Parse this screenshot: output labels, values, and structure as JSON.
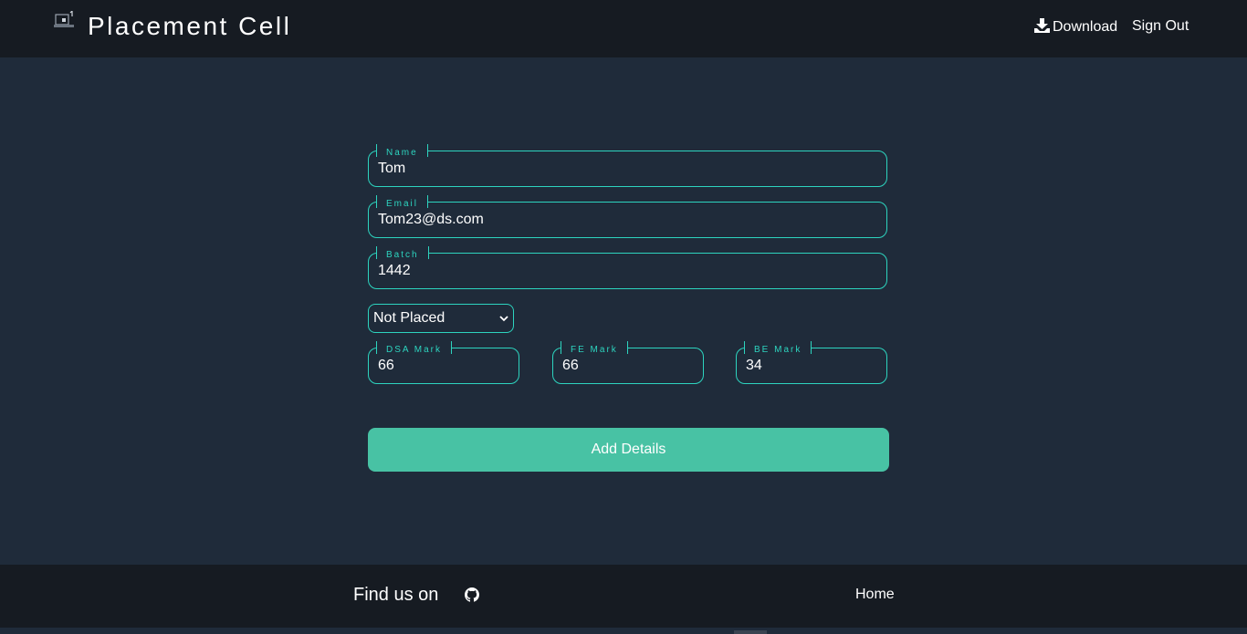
{
  "header": {
    "brand": "Placement Cell",
    "logo_icon": "laptop-icon",
    "nav": {
      "download_label": "Download",
      "download_icon": "download-icon",
      "signout_label": "Sign Out"
    }
  },
  "form": {
    "name": {
      "label": "Name",
      "value": "Tom"
    },
    "email": {
      "label": "Email",
      "value": "Tom23@ds.com"
    },
    "batch": {
      "label": "Batch",
      "value": "1442"
    },
    "status": {
      "selected": "Not Placed"
    },
    "dsa": {
      "label": "DSA Mark",
      "value": "66"
    },
    "fe": {
      "label": "FE Mark",
      "value": "66"
    },
    "be": {
      "label": "BE Mark",
      "value": "34"
    },
    "submit_label": "Add Details"
  },
  "footer": {
    "find_us": "Find us on",
    "github_icon": "github-icon",
    "home_label": "Home"
  },
  "colors": {
    "accent": "#2dd4bf",
    "button": "#48c2a4",
    "background": "#1f2b3a",
    "bar": "#161b22"
  }
}
